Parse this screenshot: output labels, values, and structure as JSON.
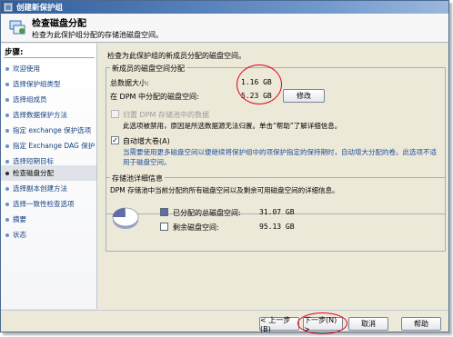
{
  "window": {
    "title": "创建新保护组"
  },
  "header": {
    "title": "检查磁盘分配",
    "subtitle": "检查为此保护组分配的存储池磁盘空间。"
  },
  "sidebar": {
    "title": "步骤:",
    "items": [
      {
        "label": "欢迎使用"
      },
      {
        "label": "选择保护组类型"
      },
      {
        "label": "选择组成员"
      },
      {
        "label": "选择数据保护方法"
      },
      {
        "label": "指定 exchange 保护选项"
      },
      {
        "label": "指定 Exchange DAG 保护"
      },
      {
        "label": "选择短期目标"
      },
      {
        "label": "检查磁盘分配"
      },
      {
        "label": "选择副本创建方法"
      },
      {
        "label": "选择一致性检查选项"
      },
      {
        "label": "摘要"
      },
      {
        "label": "状态"
      }
    ],
    "active_index": 7
  },
  "main": {
    "intro": "检查为此保护组的新成员分配的磁盘空间。",
    "allocation": {
      "group_title": "新成员的磁盘空间分配",
      "total_label": "总数据大小:",
      "total_value": "1.16 GB",
      "dpm_label": "在 DPM 中分配的磁盘空间:",
      "dpm_value": "5.23 GB",
      "modify_button": "修改",
      "colocate_label": "归置 DPM 存储池中的数据",
      "colocate_checked": false,
      "colocate_note": "此选项被禁用，原因是所选数据源无法归置。单击“帮助”了解详细信息。",
      "autogrow_label": "自动增大卷(A)",
      "autogrow_checked": true,
      "autogrow_note": "当需要使用更多磁盘空间以便继续将保护组中的项保护指定的保持期时，自动增大分配的卷。此选项不适用于磁盘空间。"
    },
    "storage": {
      "group_title": "存储池详细信息",
      "description": "DPM 存储池中当前分配的所有磁盘空间以及剩余可用磁盘空间的详细信息。",
      "allocated_label": "已分配的总磁盘空间:",
      "allocated_value": "31.07 GB",
      "free_label": "剩余磁盘空间:",
      "free_value": "95.13 GB",
      "allocated_color": "#5f6ea6",
      "free_color": "#ffffff"
    }
  },
  "footer": {
    "back": "< 上一步(B)",
    "next": "下一步(N) >",
    "cancel": "取消",
    "help": "帮助"
  },
  "colors": {
    "title_bar": "#2f5c9a",
    "highlight_circle": "#e0001a",
    "link_text": "#15407f"
  }
}
